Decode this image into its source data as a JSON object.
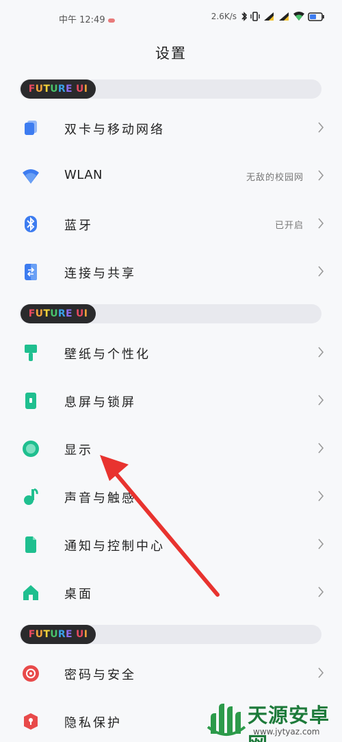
{
  "status_bar": {
    "time": "中午 12:49",
    "net_speed": "2.6K/s"
  },
  "page_title": "设置",
  "section_badge": "FUTURE UI",
  "badge_colors": {
    "F": "#e84a5f",
    "U": "#f2a33a",
    "T": "#f5d43a",
    "U2": "#49c36b",
    "R": "#3aa0e8",
    "E": "#8a6cf0",
    "U3": "#e84a5f",
    "I": "#f2a33a"
  },
  "groups": [
    {
      "items": [
        {
          "label": "双卡与移动网络",
          "value": "",
          "icon": "sim-card-icon",
          "color": "#3d7cf0"
        },
        {
          "label": "WLAN",
          "value": "无敌的校园网",
          "icon": "wifi-icon",
          "color": "#3d7cf0"
        },
        {
          "label": "蓝牙",
          "value": "已开启",
          "icon": "bluetooth-icon",
          "color": "#3d7cf0"
        },
        {
          "label": "连接与共享",
          "value": "",
          "icon": "share-icon",
          "color": "#3d7cf0"
        }
      ]
    },
    {
      "items": [
        {
          "label": "壁纸与个性化",
          "value": "",
          "icon": "paint-brush-icon",
          "color": "#1fbf8f"
        },
        {
          "label": "息屏与锁屏",
          "value": "",
          "icon": "lock-screen-icon",
          "color": "#1fbf8f"
        },
        {
          "label": "显示",
          "value": "",
          "icon": "display-icon",
          "color": "#1fbf8f"
        },
        {
          "label": "声音与触感",
          "value": "",
          "icon": "music-note-icon",
          "color": "#1fbf8f"
        },
        {
          "label": "通知与控制中心",
          "value": "",
          "icon": "notification-icon",
          "color": "#1fbf8f"
        },
        {
          "label": "桌面",
          "value": "",
          "icon": "home-icon",
          "color": "#1fbf8f"
        }
      ]
    },
    {
      "items": [
        {
          "label": "密码与安全",
          "value": "",
          "icon": "password-icon",
          "color": "#e84a4a"
        },
        {
          "label": "隐私保护",
          "value": "",
          "icon": "privacy-icon",
          "color": "#e84a4a"
        }
      ]
    }
  ],
  "watermark": {
    "title": "天源安卓网",
    "url": "www.jytyaz.com"
  }
}
